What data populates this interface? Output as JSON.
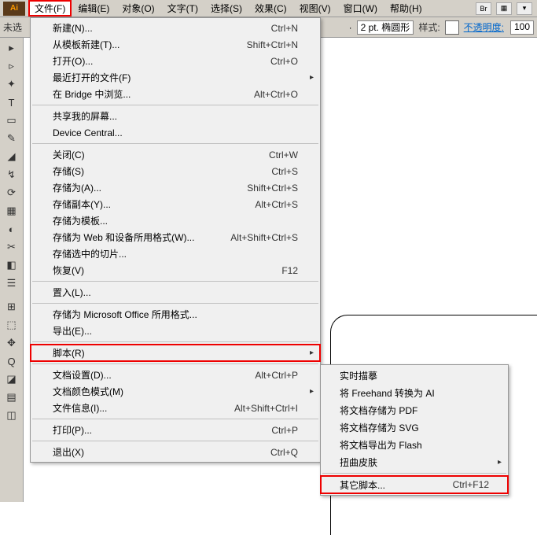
{
  "menubar": {
    "items": [
      "文件(F)",
      "编辑(E)",
      "对象(O)",
      "文字(T)",
      "选择(S)",
      "效果(C)",
      "视图(V)",
      "窗口(W)",
      "帮助(H)"
    ],
    "right_icons": [
      "Br",
      "▦",
      "▾"
    ]
  },
  "toolbar": {
    "left_label": "未选",
    "stroke_label": "2 pt. 椭圆形",
    "style_label": "样式:",
    "opacity_label": "不透明度:",
    "opacity_value": "100"
  },
  "tools": [
    "▸",
    "▹",
    "✦",
    "T",
    "▭",
    "✎",
    "◢",
    "↯",
    "⟳",
    "▦",
    "◐",
    "✂",
    "◧",
    "☰",
    "⊞",
    "⬚",
    "✥",
    "Q",
    "◪",
    "▤",
    "◫"
  ],
  "file_menu": [
    {
      "label": "新建(N)...",
      "shortcut": "Ctrl+N"
    },
    {
      "label": "从模板新建(T)...",
      "shortcut": "Shift+Ctrl+N"
    },
    {
      "label": "打开(O)...",
      "shortcut": "Ctrl+O"
    },
    {
      "label": "最近打开的文件(F)",
      "shortcut": "",
      "arrow": true
    },
    {
      "label": "在 Bridge 中浏览...",
      "shortcut": "Alt+Ctrl+O"
    },
    {
      "sep": true
    },
    {
      "label": "共享我的屏幕...",
      "shortcut": ""
    },
    {
      "label": "Device Central...",
      "shortcut": ""
    },
    {
      "sep": true
    },
    {
      "label": "关闭(C)",
      "shortcut": "Ctrl+W"
    },
    {
      "label": "存储(S)",
      "shortcut": "Ctrl+S"
    },
    {
      "label": "存储为(A)...",
      "shortcut": "Shift+Ctrl+S"
    },
    {
      "label": "存储副本(Y)...",
      "shortcut": "Alt+Ctrl+S"
    },
    {
      "label": "存储为模板...",
      "shortcut": ""
    },
    {
      "label": "存储为 Web 和设备所用格式(W)...",
      "shortcut": "Alt+Shift+Ctrl+S"
    },
    {
      "label": "存储选中的切片...",
      "shortcut": ""
    },
    {
      "label": "恢复(V)",
      "shortcut": "F12"
    },
    {
      "sep": true
    },
    {
      "label": "置入(L)...",
      "shortcut": ""
    },
    {
      "sep": true
    },
    {
      "label": "存储为 Microsoft Office 所用格式...",
      "shortcut": ""
    },
    {
      "label": "导出(E)...",
      "shortcut": ""
    },
    {
      "sep": true
    },
    {
      "label": "脚本(R)",
      "shortcut": "",
      "arrow": true,
      "boxed": true
    },
    {
      "sep": true
    },
    {
      "label": "文档设置(D)...",
      "shortcut": "Alt+Ctrl+P"
    },
    {
      "label": "文档颜色模式(M)",
      "shortcut": "",
      "arrow": true
    },
    {
      "label": "文件信息(I)...",
      "shortcut": "Alt+Shift+Ctrl+I"
    },
    {
      "sep": true
    },
    {
      "label": "打印(P)...",
      "shortcut": "Ctrl+P"
    },
    {
      "sep": true
    },
    {
      "label": "退出(X)",
      "shortcut": "Ctrl+Q"
    }
  ],
  "script_submenu": [
    {
      "label": "实时描摹",
      "shortcut": ""
    },
    {
      "label": "将 Freehand 转换为 AI",
      "shortcut": ""
    },
    {
      "label": "将文档存储为 PDF",
      "shortcut": ""
    },
    {
      "label": "将文档存储为 SVG",
      "shortcut": ""
    },
    {
      "label": "将文档导出为 Flash",
      "shortcut": ""
    },
    {
      "label": "扭曲皮肤",
      "shortcut": "",
      "arrow": true
    },
    {
      "sep": true
    },
    {
      "label": "其它脚本...",
      "shortcut": "Ctrl+F12",
      "boxed": true
    }
  ]
}
